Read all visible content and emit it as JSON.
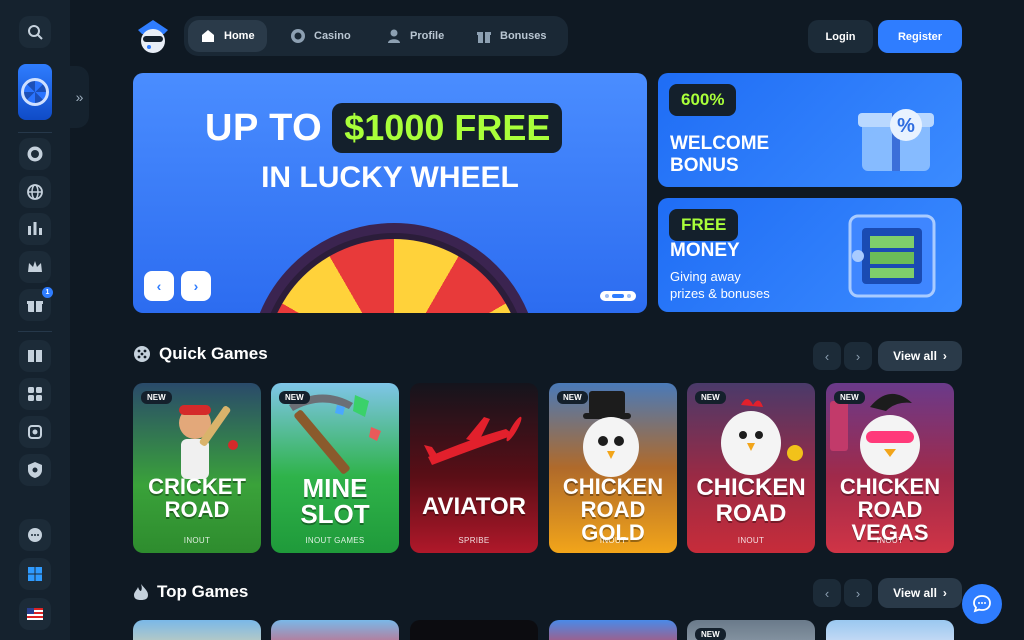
{
  "nav": {
    "items": [
      {
        "label": "Home",
        "icon": "home-icon",
        "active": true
      },
      {
        "label": "Casino",
        "icon": "casino-chip-icon",
        "active": false
      },
      {
        "label": "Profile",
        "icon": "user-icon",
        "active": false
      },
      {
        "label": "Bonuses",
        "icon": "gift-icon",
        "active": false
      }
    ],
    "login_label": "Login",
    "register_label": "Register"
  },
  "sidebar": {
    "icons": [
      "search-icon",
      "casino-chip-icon",
      "globe-icon",
      "sports-chart-icon",
      "crown-icon",
      "gift-icon",
      "book-icon",
      "puzzle-icon",
      "chip-stack-icon",
      "shield-icon",
      "support-chat-icon",
      "windows-icon",
      "us-flag-icon"
    ],
    "gift_badge": "1"
  },
  "hero": {
    "line1_prefix": "UP TO",
    "line1_amount": "$1000 FREE",
    "line2": "IN LUCKY WHEEL",
    "prev_label": "‹",
    "next_label": "›"
  },
  "promos": [
    {
      "tag": "600%",
      "title_line1": "WELCOME",
      "title_line2": "BONUS"
    },
    {
      "tag": "FREE",
      "title": "MONEY",
      "sub_line1": "Giving away",
      "sub_line2": "prizes & bonuses"
    }
  ],
  "quick_games": {
    "title": "Quick Games",
    "view_all": "View all",
    "cards": [
      {
        "name_line1": "CRICKET",
        "name_line2": "ROAD",
        "provider": "INOUT",
        "is_new": true,
        "new_label": "NEW",
        "color": "#3aa23a"
      },
      {
        "name_line1": "MINE",
        "name_line2": "SLOT",
        "provider": "INOUT GAMES",
        "is_new": true,
        "new_label": "NEW",
        "color": "#2fb34a"
      },
      {
        "name_line1": "AVIATOR",
        "name_line2": "",
        "provider": "SPRIBE",
        "is_new": false,
        "new_label": "",
        "color": "#8e1420"
      },
      {
        "name_line1": "CHICKEN",
        "name_line2": "ROAD GOLD",
        "provider": "INOUT",
        "is_new": true,
        "new_label": "NEW",
        "color": "#f2a51a"
      },
      {
        "name_line1": "CHICKEN",
        "name_line2": "ROAD",
        "provider": "INOUT",
        "is_new": true,
        "new_label": "NEW",
        "color": "#c72c3a"
      },
      {
        "name_line1": "CHICKEN",
        "name_line2": "ROAD VEGAS",
        "provider": "INOUT",
        "is_new": true,
        "new_label": "NEW",
        "color": "#d03446"
      }
    ]
  },
  "top_games": {
    "title": "Top Games",
    "view_all": "View all",
    "new_label": "NEW"
  }
}
